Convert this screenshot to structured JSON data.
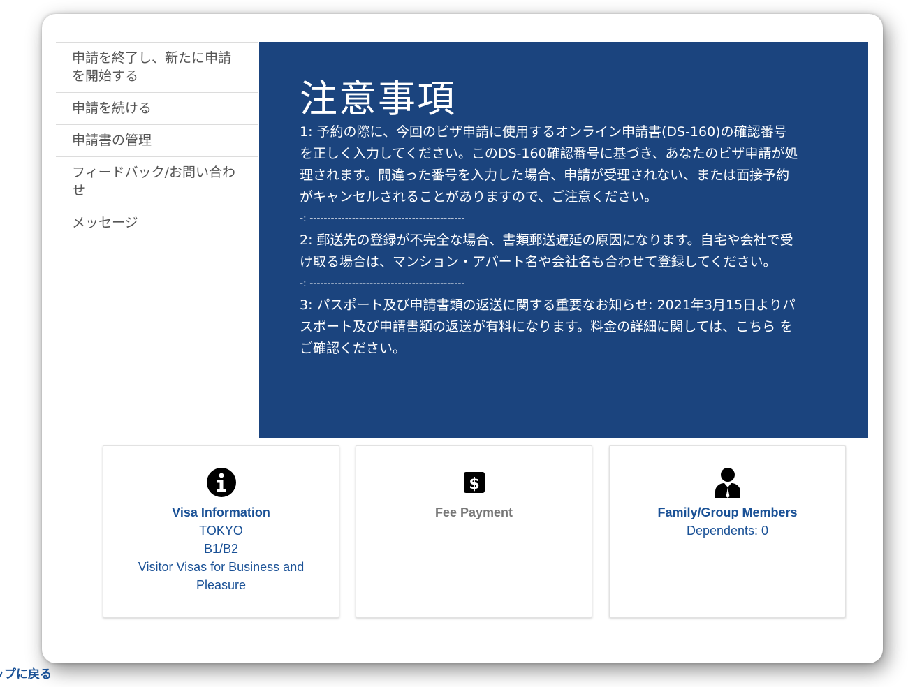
{
  "sidebar": {
    "items": [
      {
        "label": "申請を終了し、新たに申請を開始する"
      },
      {
        "label": "申請を続ける"
      },
      {
        "label": "申請書の管理"
      },
      {
        "label": "フィードバック/お問い合わせ"
      },
      {
        "label": "メッセージ"
      }
    ]
  },
  "notice": {
    "title": "注意事項",
    "para1": "1: 予約の際に、今回のビザ申請に使用するオンライン申請書(DS-160)の確認番号を正しく入力してください。このDS-160確認番号に基づき、あなたのビザ申請が処理されます。間違った番号を入力した場合、申請が受理されない、または面接予約がキャンセルされることがありますので、ご注意ください。",
    "separator1": "-: --------------------------------------------",
    "para2": "2: 郵送先の登録が不完全な場合、書類郵送遅延の原因になります。自宅や会社で受け取る場合は、マンション・アパート名や会社名も合わせて登録してください。",
    "separator2": "-: --------------------------------------------",
    "para3": "3: パスポート及び申請書類の返送に関する重要なお知らせ: 2021年3月15日よりパスポート及び申請書類の返送が有料になります。料金の詳細に関しては、こちら をご確認ください。"
  },
  "cards": {
    "visa": {
      "icon": "info-circle-icon",
      "title": "Visa Information",
      "location": "TOKYO",
      "visa_class": "B1/B2",
      "visa_desc": "Visitor Visas for Business and Pleasure"
    },
    "fee": {
      "icon": "dollar-icon",
      "title": "Fee Payment"
    },
    "family": {
      "icon": "user-tie-icon",
      "title": "Family/Group Members",
      "dependents": "Dependents: 0"
    }
  },
  "footer": {
    "back_link": "トップに戻る"
  },
  "colors": {
    "notice_bg": "#1b447e",
    "link": "#1a5196",
    "muted": "#777777"
  }
}
